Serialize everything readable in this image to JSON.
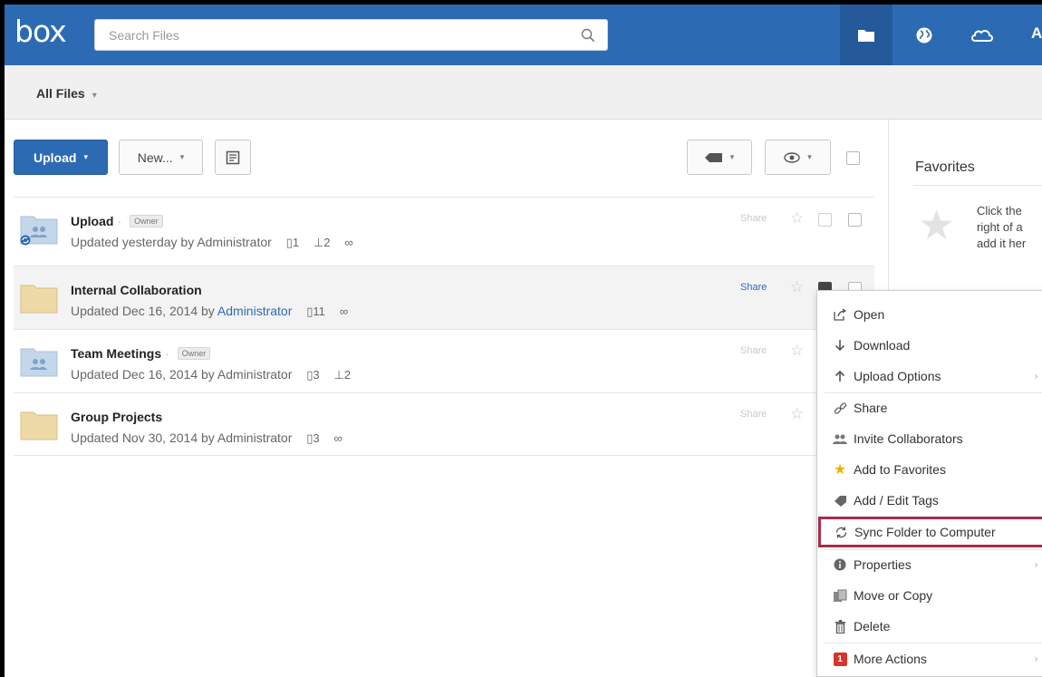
{
  "header": {
    "logo": "box",
    "search_placeholder": "Search Files",
    "nav": [
      {
        "id": "files",
        "icon": "folder-icon",
        "active": true
      },
      {
        "id": "web",
        "icon": "globe-icon",
        "active": false
      },
      {
        "id": "sync",
        "icon": "cloud-icon",
        "active": false
      }
    ],
    "cut_off_letter": "A",
    "colors": {
      "bar": "#2c6bb4",
      "active_tab": "#24599a"
    }
  },
  "breadcrumb": {
    "label": "All Files"
  },
  "toolbar": {
    "upload_label": "Upload",
    "new_label": "New...",
    "note_icon": "note-icon",
    "tag_icon": "tag-icon",
    "view_icon": "eye-icon"
  },
  "files": [
    {
      "name": "Upload",
      "owner_badge": "Owner",
      "updated": "Updated yesterday by ",
      "who": "Administrator",
      "who_link": false,
      "file_count": "1",
      "collab_count": "2",
      "has_link": true,
      "share": "Share",
      "icon": "shared-folder-sync-icon"
    },
    {
      "name": "Internal Collaboration",
      "owner_badge": "",
      "updated": "Updated Dec 16, 2014 by ",
      "who": "Administrator",
      "who_link": true,
      "file_count": "11",
      "collab_count": "",
      "has_link": true,
      "share": "Share",
      "icon": "folder-icon"
    },
    {
      "name": "Team Meetings",
      "owner_badge": "Owner",
      "updated": "Updated Dec 16, 2014 by ",
      "who": "Administrator",
      "who_link": false,
      "file_count": "3",
      "collab_count": "2",
      "has_link": false,
      "share": "Share",
      "icon": "shared-folder-icon"
    },
    {
      "name": "Group Projects",
      "owner_badge": "",
      "updated": "Updated Nov 30, 2014 by ",
      "who": "Administrator",
      "who_link": false,
      "file_count": "3",
      "collab_count": "",
      "has_link": true,
      "share": "Share",
      "icon": "folder-icon"
    }
  ],
  "right_panel": {
    "title": "Favorites",
    "hint_lines": [
      "Click the",
      "right of a",
      "add it her"
    ]
  },
  "context_menu": {
    "items": [
      {
        "label": "Open",
        "icon": "open-external-icon"
      },
      {
        "label": "Download",
        "icon": "download-arrow-icon"
      },
      {
        "label": "Upload Options",
        "icon": "upload-arrow-icon",
        "submenu": true
      },
      {
        "label": "Share",
        "icon": "link-icon"
      },
      {
        "label": "Invite Collaborators",
        "icon": "collaborators-icon"
      },
      {
        "label": "Add to Favorites",
        "icon": "star-icon"
      },
      {
        "label": "Add / Edit Tags",
        "icon": "tag-icon"
      },
      {
        "label": "Sync Folder to Computer",
        "icon": "sync-icon",
        "selected": true
      },
      {
        "label": "Properties",
        "icon": "info-icon",
        "submenu": true
      },
      {
        "label": "Move or Copy",
        "icon": "move-copy-icon"
      },
      {
        "label": "Delete",
        "icon": "trash-icon"
      },
      {
        "label": "More Actions",
        "icon": "more-actions-icon",
        "badge": "1",
        "submenu": true
      }
    ],
    "highlight_color": "#a72b4c"
  }
}
